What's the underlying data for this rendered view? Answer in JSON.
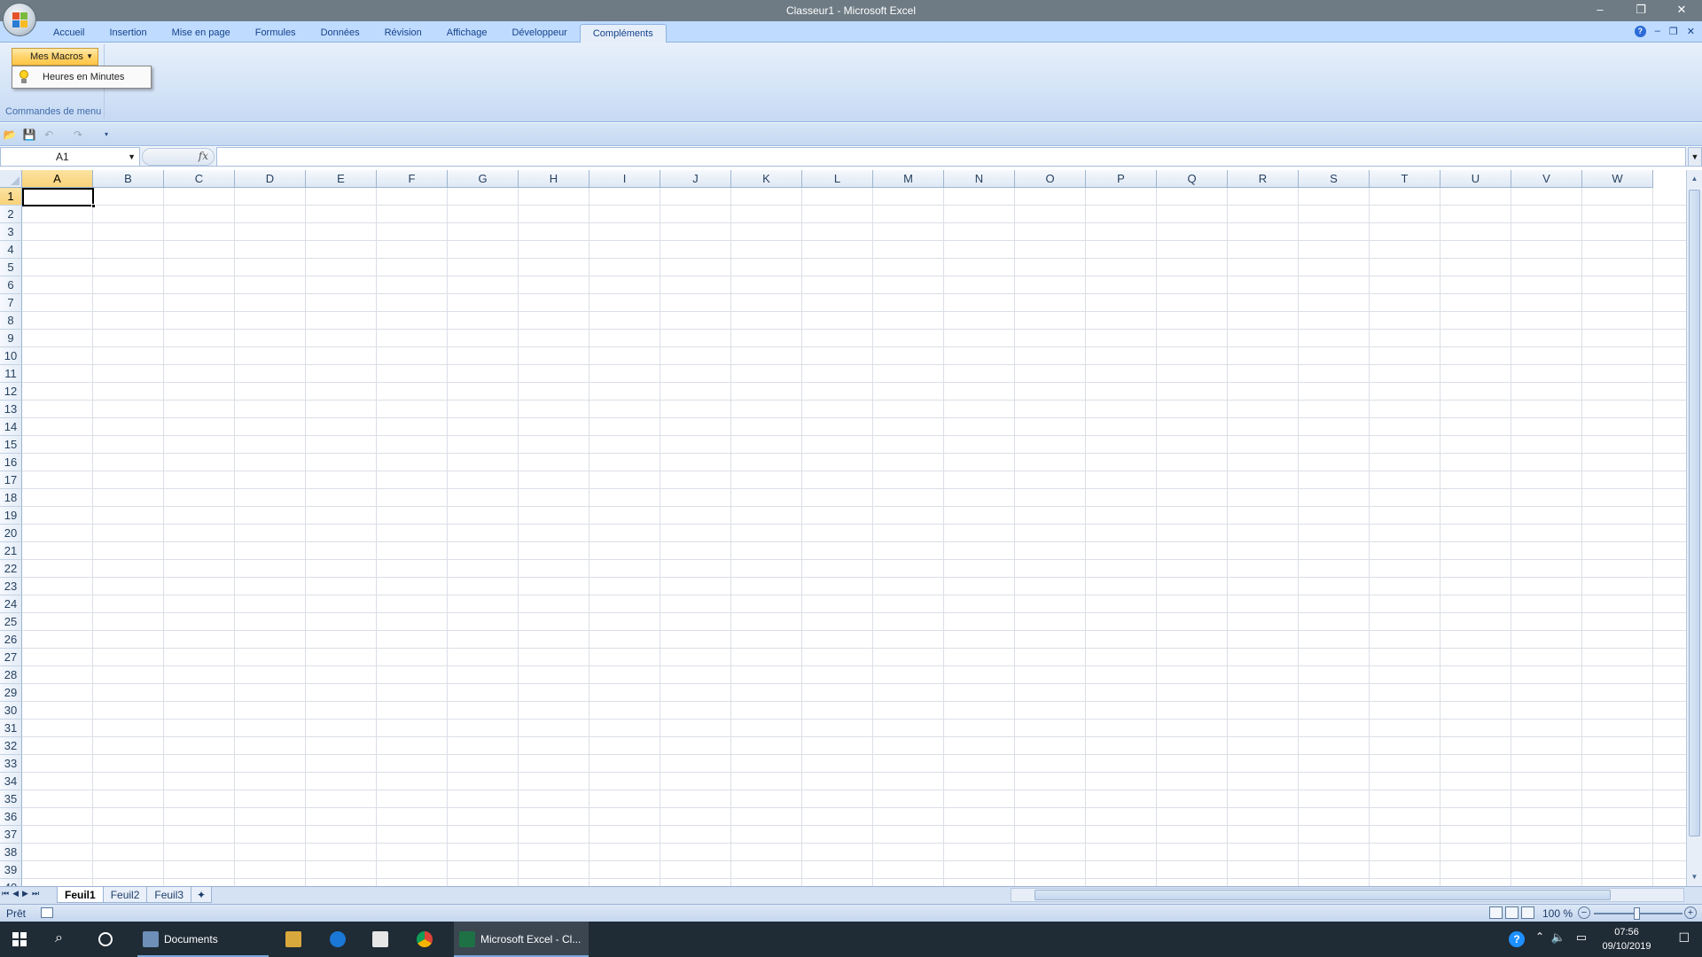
{
  "window": {
    "title": "Classeur1 - Microsoft Excel",
    "controls": [
      "–",
      "❐",
      "✕"
    ]
  },
  "ribbon": {
    "tabs": [
      "Accueil",
      "Insertion",
      "Mise en page",
      "Formules",
      "Données",
      "Révision",
      "Affichage",
      "Développeur",
      "Compléments"
    ],
    "active_tab": "Compléments",
    "group_label": "Commandes de menu",
    "macro_button": "Mes Macros",
    "dropdown_item": "Heures en Minutes"
  },
  "formula_bar": {
    "name_box": "A1",
    "fx": "fx",
    "value": ""
  },
  "grid": {
    "columns": [
      "A",
      "B",
      "C",
      "D",
      "E",
      "F",
      "G",
      "H",
      "I",
      "J",
      "K",
      "L",
      "M",
      "N",
      "O",
      "P",
      "Q",
      "R",
      "S",
      "T",
      "U",
      "V",
      "W"
    ],
    "rows": [
      "1",
      "2",
      "3",
      "4",
      "5",
      "6",
      "7",
      "8",
      "9",
      "10",
      "11",
      "12",
      "13",
      "14",
      "15",
      "16",
      "17",
      "18",
      "19",
      "20",
      "21",
      "22",
      "23",
      "24",
      "25",
      "26",
      "27",
      "28",
      "29",
      "30",
      "31",
      "32",
      "33",
      "34",
      "35",
      "36",
      "37",
      "38",
      "39",
      "40"
    ],
    "selected_column": "A",
    "selected_row": "1"
  },
  "sheets": {
    "tabs": [
      "Feuil1",
      "Feuil2",
      "Feuil3"
    ],
    "active": "Feuil1"
  },
  "status": {
    "text": "Prêt",
    "zoom": "100 %"
  },
  "taskbar": {
    "documents_label": "Documents",
    "excel_label": "Microsoft Excel - Cl...",
    "time": "07:56",
    "date": "09/10/2019"
  }
}
